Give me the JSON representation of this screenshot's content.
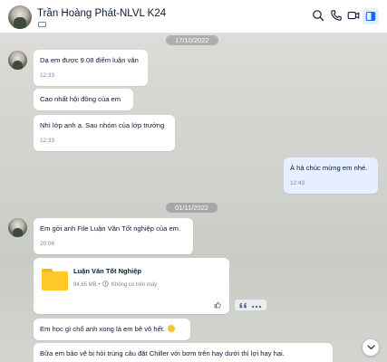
{
  "header": {
    "title": "Trần Hoàng Phát-NLVL K24",
    "icons": [
      "search-icon",
      "phone-icon",
      "video-icon",
      "sidebar-toggle-icon"
    ],
    "accent_color": "#0068ff"
  },
  "dates": {
    "first": "17/10/2022",
    "second": "01/11/2022"
  },
  "messages": {
    "m1": {
      "text": "Dạ em được 9.08 điểm luận văn",
      "time": "12:33"
    },
    "m2": {
      "text": "Cao nhất hội đồng của em"
    },
    "m3": {
      "text": "Nhì lớp anh ạ. Sau nhóm của lớp trưởng",
      "time": "12:33"
    },
    "m4": {
      "text": "À hả chúc mừng em nhé.",
      "time": "12:43"
    },
    "m5": {
      "text": "Em gởi anh File Luận Văn Tốt nghiệp của em.",
      "time": "20:06"
    },
    "file": {
      "name": "Luận Văn Tốt Nghiệp",
      "size": "84.65 MB",
      "separator": "•",
      "status": "Không có trên máy"
    },
    "m6": {
      "text": "Em học gì chổ anh xong là em bê vô hết.",
      "emoji": "emoji-icon"
    },
    "m7": {
      "text": "Bữa em bảo vệ bị hỏi trùng câu đặt Chiller với bơm trên hay dưới thì lợi hay hại."
    }
  }
}
